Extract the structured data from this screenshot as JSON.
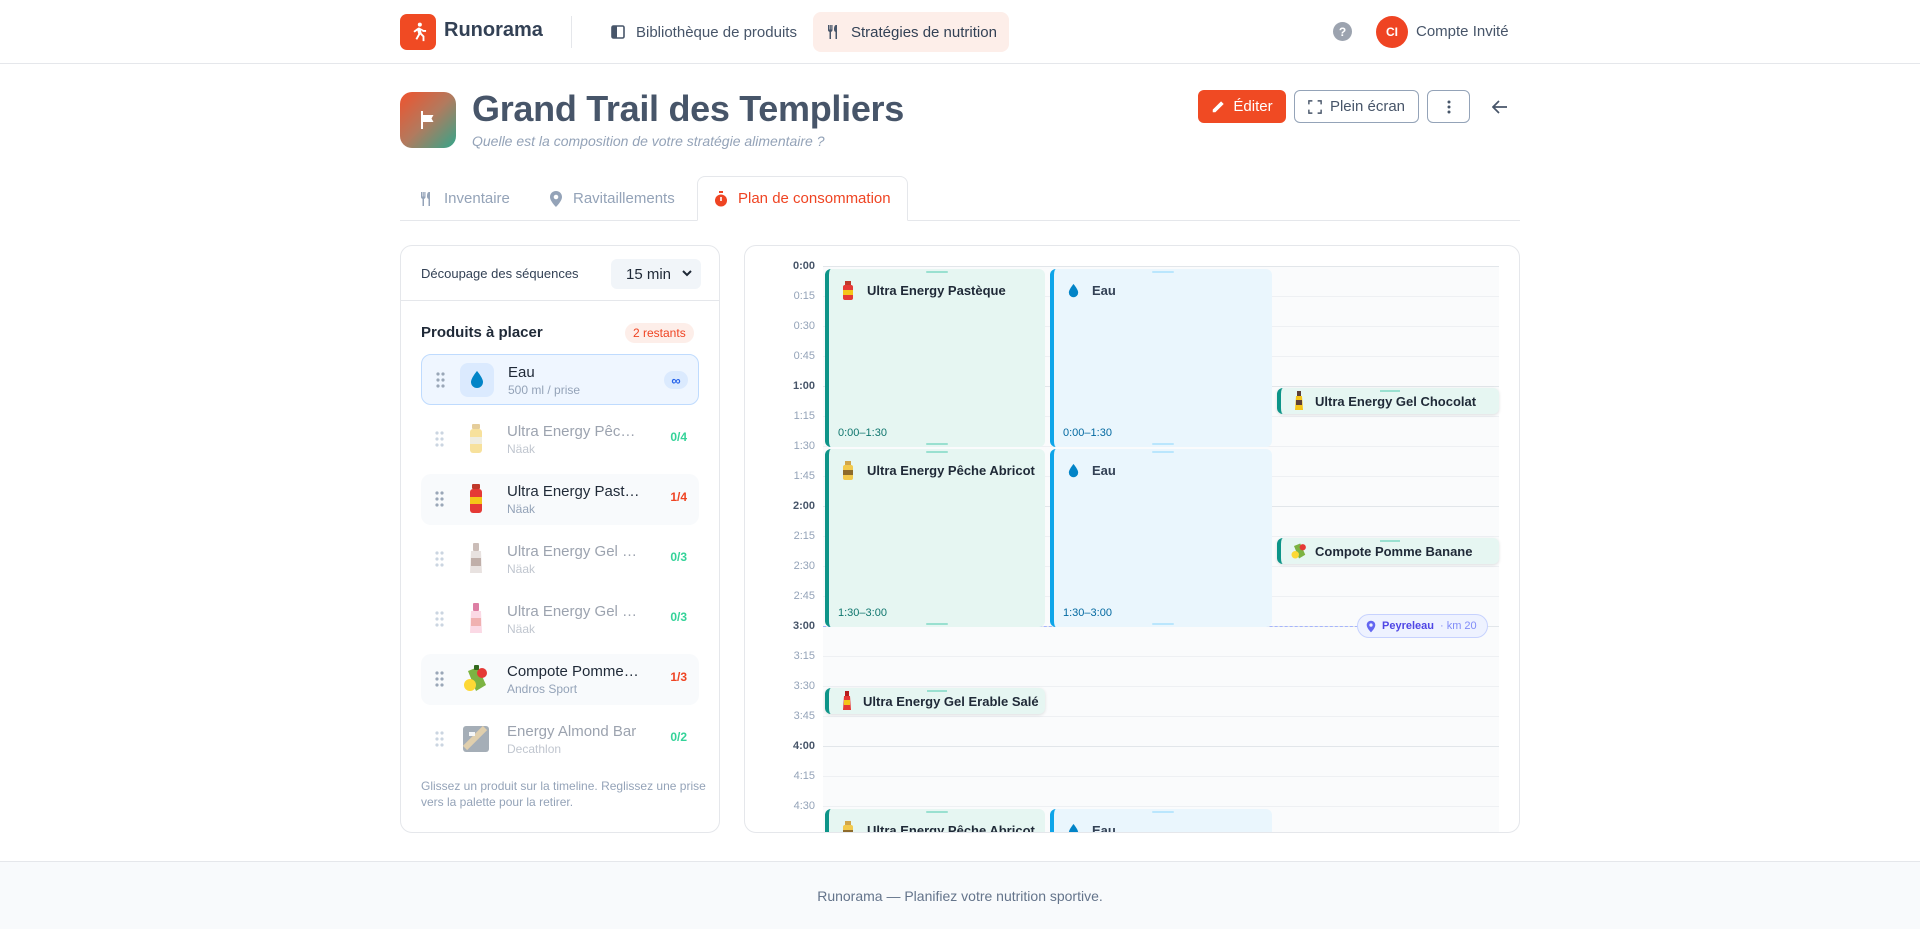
{
  "nav": {
    "brand": "Runorama",
    "links": [
      {
        "label": "Bibliothèque de produits"
      },
      {
        "label": "Stratégies de nutrition"
      }
    ],
    "help": "?",
    "avatar_initials": "CI",
    "account": "Compte Invité"
  },
  "header": {
    "title": "Grand Trail des Templiers",
    "subtitle": "Quelle est la composition de votre stratégie alimentaire ?",
    "edit": "Éditer",
    "fullscreen": "Plein écran"
  },
  "tabs": [
    {
      "label": "Inventaire"
    },
    {
      "label": "Ravitaillements"
    },
    {
      "label": "Plan de consommation"
    }
  ],
  "palette": {
    "sequence_label": "Découpage des séquences",
    "sequence_value": "15 min",
    "title": "Produits à placer",
    "remaining": "2 restants",
    "products": [
      {
        "name": "Eau",
        "sub": "500 ml / prise",
        "count": "∞"
      },
      {
        "name": "Ultra Energy Pêche Abricot",
        "sub": "Näak",
        "count": "0/4"
      },
      {
        "name": "Ultra Energy Pastèque",
        "sub": "Näak",
        "count": "1/4"
      },
      {
        "name": "Ultra Energy Gel Chocolat",
        "sub": "Näak",
        "count": "0/3"
      },
      {
        "name": "Ultra Energy Gel Erable Salé",
        "sub": "Näak",
        "count": "0/3"
      },
      {
        "name": "Compote Pomme Banane",
        "sub": "Andros Sport",
        "count": "1/3"
      },
      {
        "name": "Energy Almond Bar",
        "sub": "Decathlon",
        "count": "0/2"
      }
    ],
    "hint": "Glissez un produit sur la timeline. Reglissez une prise vers la palette pour la retirer."
  },
  "timeline": {
    "times": [
      "0:00",
      "0:15",
      "0:30",
      "0:45",
      "1:00",
      "1:15",
      "1:30",
      "1:45",
      "2:00",
      "2:15",
      "2:30",
      "2:45",
      "3:00",
      "3:15",
      "3:30",
      "3:45",
      "4:00",
      "4:15",
      "4:30"
    ],
    "blocks": [
      {
        "name": "Ultra Energy Pastèque",
        "range": "0:00–1:30"
      },
      {
        "name": "Eau",
        "range": "0:00–1:30"
      },
      {
        "name": "Ultra Energy Pêche Abricot",
        "range": "1:30–3:00"
      },
      {
        "name": "Eau",
        "range": "1:30–3:00"
      },
      {
        "name": "Ultra Energy Pêche Abricot",
        "range": ""
      },
      {
        "name": "Eau",
        "range": ""
      }
    ],
    "chips": [
      {
        "name": "Ultra Energy Gel Chocolat"
      },
      {
        "name": "Compote Pomme Banane"
      },
      {
        "name": "Ultra Energy Gel Erable Salé"
      }
    ],
    "refuel": {
      "name": "Peyreleau",
      "km": "· km 20"
    }
  },
  "footer": "Runorama — Planifiez votre nutrition sportive.",
  "colors": {
    "accent": "#f04a23",
    "teal": "#0d9488",
    "water": "#0ea5e9"
  }
}
